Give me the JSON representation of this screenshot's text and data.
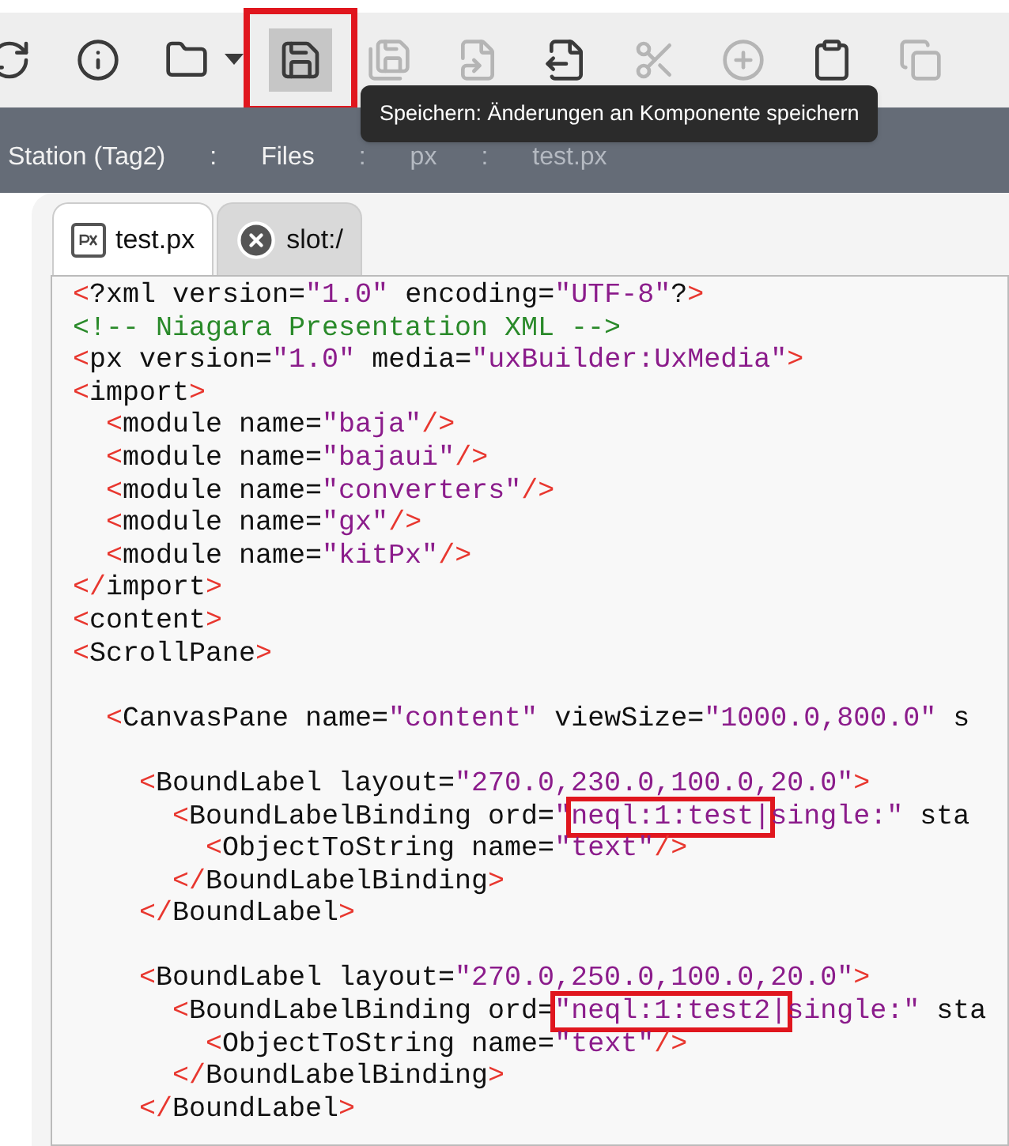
{
  "toolbar": [
    {
      "disabled": false,
      "selected": false
    },
    {
      "disabled": false,
      "selected": false
    },
    {
      "disabled": false,
      "selected": false
    },
    {
      "disabled": false,
      "selected": true,
      "annotated": true
    },
    {
      "disabled": true,
      "selected": false
    },
    {
      "disabled": true,
      "selected": false
    },
    {
      "disabled": false,
      "selected": false
    },
    {
      "disabled": true,
      "selected": false
    },
    {
      "disabled": true,
      "selected": false
    },
    {
      "disabled": false,
      "selected": false
    },
    {
      "disabled": true,
      "selected": false
    }
  ],
  "tooltip": "Speichern: Änderungen an Komponente speichern",
  "breadcrumb": [
    {
      "label": "Station (Tag2)",
      "dimmed": false
    },
    {
      "label": ":",
      "dimmed": false
    },
    {
      "label": "Files",
      "dimmed": false
    },
    {
      "label": ":",
      "dimmed": true
    },
    {
      "label": "px",
      "dimmed": true
    },
    {
      "label": ":",
      "dimmed": true
    },
    {
      "label": "test.px",
      "dimmed": true
    }
  ],
  "tabs": [
    {
      "label": "test.px",
      "selected": true,
      "kind": "file"
    },
    {
      "label": "slot:/",
      "selected": false,
      "kind": "error"
    }
  ],
  "code_lines": [
    {
      "tokens": [
        {
          "kind": "punct",
          "s": "<"
        },
        {
          "kind": "text",
          "s": "?xml version="
        },
        {
          "kind": "value",
          "s": "\"1.0\""
        },
        {
          "kind": "text",
          "s": " encoding="
        },
        {
          "kind": "value",
          "s": "\"UTF-8\""
        },
        {
          "kind": "text",
          "s": "?"
        },
        {
          "kind": "punct",
          "s": ">"
        }
      ]
    },
    {
      "tokens": [
        {
          "kind": "comment",
          "s": "<!-- Niagara Presentation XML -->"
        }
      ]
    },
    {
      "tokens": [
        {
          "kind": "punct",
          "s": "<"
        },
        {
          "kind": "text",
          "s": "px version="
        },
        {
          "kind": "value",
          "s": "\"1.0\""
        },
        {
          "kind": "text",
          "s": " media="
        },
        {
          "kind": "value",
          "s": "\"uxBuilder:UxMedia\""
        },
        {
          "kind": "punct",
          "s": ">"
        }
      ]
    },
    {
      "tokens": [
        {
          "kind": "punct",
          "s": "<"
        },
        {
          "kind": "text",
          "s": "import"
        },
        {
          "kind": "punct",
          "s": ">"
        }
      ],
      "children": [
        {
          "tokens": [
            {
              "kind": "punct",
              "s": "<"
            },
            {
              "kind": "text",
              "s": "module name="
            },
            {
              "kind": "value",
              "s": "\"baja\""
            },
            {
              "kind": "punct",
              "s": "/>"
            }
          ]
        },
        {
          "tokens": [
            {
              "kind": "punct",
              "s": "<"
            },
            {
              "kind": "text",
              "s": "module name="
            },
            {
              "kind": "value",
              "s": "\"bajaui\""
            },
            {
              "kind": "punct",
              "s": "/>"
            }
          ]
        },
        {
          "tokens": [
            {
              "kind": "punct",
              "s": "<"
            },
            {
              "kind": "text",
              "s": "module name="
            },
            {
              "kind": "value",
              "s": "\"converters\""
            },
            {
              "kind": "punct",
              "s": "/>"
            }
          ]
        },
        {
          "tokens": [
            {
              "kind": "punct",
              "s": "<"
            },
            {
              "kind": "text",
              "s": "module name="
            },
            {
              "kind": "value",
              "s": "\"gx\""
            },
            {
              "kind": "punct",
              "s": "/>"
            }
          ]
        },
        {
          "tokens": [
            {
              "kind": "punct",
              "s": "<"
            },
            {
              "kind": "text",
              "s": "module name="
            },
            {
              "kind": "value",
              "s": "\"kitPx\""
            },
            {
              "kind": "punct",
              "s": "/>"
            }
          ]
        }
      ]
    },
    {
      "tokens": [
        {
          "kind": "punct",
          "s": "</"
        },
        {
          "kind": "text",
          "s": "import"
        },
        {
          "kind": "punct",
          "s": ">"
        }
      ]
    },
    {
      "tokens": [
        {
          "kind": "punct",
          "s": "<"
        },
        {
          "kind": "text",
          "s": "content"
        },
        {
          "kind": "punct",
          "s": ">"
        }
      ]
    },
    {
      "tokens": [
        {
          "kind": "punct",
          "s": "<"
        },
        {
          "kind": "text",
          "s": "ScrollPane"
        },
        {
          "kind": "punct",
          "s": ">"
        }
      ],
      "children": [
        {
          "kind": "blank"
        },
        {
          "tokens": [
            {
              "kind": "punct",
              "s": "<"
            },
            {
              "kind": "text",
              "s": "CanvasPane name="
            },
            {
              "kind": "value",
              "s": "\"content\""
            },
            {
              "kind": "text",
              "s": " viewSize="
            },
            {
              "kind": "value",
              "s": "\"1000.0,800.0\""
            },
            {
              "kind": "text",
              "s": " s"
            }
          ],
          "children": [
            {
              "kind": "blank"
            },
            {
              "tokens": [
                {
                  "kind": "punct",
                  "s": "<"
                },
                {
                  "kind": "text",
                  "s": "BoundLabel layout="
                },
                {
                  "kind": "value",
                  "s": "\"270.0,230.0,100.0,20.0\""
                },
                {
                  "kind": "punct",
                  "s": ">"
                }
              ],
              "children": [
                {
                  "tokens": [
                    {
                      "kind": "punct",
                      "s": "<"
                    },
                    {
                      "kind": "text",
                      "s": "BoundLabelBinding ord="
                    },
                    {
                      "kind": "value",
                      "s": "\""
                    },
                    {
                      "kind": "value",
                      "s": "neql:1:test|",
                      "annotated": true
                    },
                    {
                      "kind": "value",
                      "s": "single:\""
                    },
                    {
                      "kind": "text",
                      "s": " sta"
                    }
                  ],
                  "children": [
                    {
                      "tokens": [
                        {
                          "kind": "punct",
                          "s": "<"
                        },
                        {
                          "kind": "text",
                          "s": "ObjectToString name="
                        },
                        {
                          "kind": "value",
                          "s": "\"text\""
                        },
                        {
                          "kind": "punct",
                          "s": "/>"
                        }
                      ]
                    }
                  ]
                },
                {
                  "tokens": [
                    {
                      "kind": "punct",
                      "s": "</"
                    },
                    {
                      "kind": "text",
                      "s": "BoundLabelBinding"
                    },
                    {
                      "kind": "punct",
                      "s": ">"
                    }
                  ]
                }
              ]
            },
            {
              "tokens": [
                {
                  "kind": "punct",
                  "s": "</"
                },
                {
                  "kind": "text",
                  "s": "BoundLabel"
                },
                {
                  "kind": "punct",
                  "s": ">"
                }
              ]
            },
            {
              "kind": "blank"
            },
            {
              "tokens": [
                {
                  "kind": "punct",
                  "s": "<"
                },
                {
                  "kind": "text",
                  "s": "BoundLabel layout="
                },
                {
                  "kind": "value",
                  "s": "\"270.0,250.0,100.0,20.0\""
                },
                {
                  "kind": "punct",
                  "s": ">"
                }
              ],
              "children": [
                {
                  "tokens": [
                    {
                      "kind": "punct",
                      "s": "<"
                    },
                    {
                      "kind": "text",
                      "s": "BoundLabelBinding ord="
                    },
                    {
                      "kind": "value",
                      "s": "\"neql:1:test2|",
                      "annotated": true
                    },
                    {
                      "kind": "value",
                      "s": "single:\""
                    },
                    {
                      "kind": "text",
                      "s": " sta"
                    }
                  ],
                  "children": [
                    {
                      "tokens": [
                        {
                          "kind": "punct",
                          "s": "<"
                        },
                        {
                          "kind": "text",
                          "s": "ObjectToString name="
                        },
                        {
                          "kind": "value",
                          "s": "\"text\""
                        },
                        {
                          "kind": "punct",
                          "s": "/>"
                        }
                      ]
                    }
                  ]
                },
                {
                  "tokens": [
                    {
                      "kind": "punct",
                      "s": "</"
                    },
                    {
                      "kind": "text",
                      "s": "BoundLabelBinding"
                    },
                    {
                      "kind": "punct",
                      "s": ">"
                    }
                  ]
                }
              ]
            },
            {
              "tokens": [
                {
                  "kind": "punct",
                  "s": "</"
                },
                {
                  "kind": "text",
                  "s": "BoundLabel"
                },
                {
                  "kind": "punct",
                  "s": ">"
                }
              ]
            }
          ]
        }
      ]
    }
  ]
}
